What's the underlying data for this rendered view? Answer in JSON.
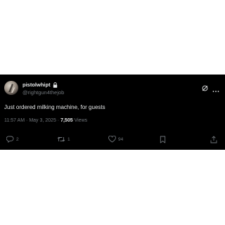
{
  "tweet": {
    "display_name": "pistolwhipt",
    "handle": "@rightgun4thejob",
    "text": "Just ordered milking machine, for guests",
    "time": "11:57 AM",
    "date": "May 3, 2025",
    "separator": "·",
    "views_count": "7,505",
    "views_label": "Views"
  },
  "actions": {
    "replies": "2",
    "reposts": "1",
    "likes": "94"
  },
  "icons": {
    "verified": "lock-icon",
    "grok": "grok-icon",
    "more": "more-icon",
    "reply": "reply-icon",
    "repost": "repost-icon",
    "like": "heart-icon",
    "bookmark": "bookmark-icon",
    "share": "share-icon"
  },
  "colors": {
    "background": "#000000",
    "text": "#e7e9ea",
    "muted": "#71767b"
  }
}
